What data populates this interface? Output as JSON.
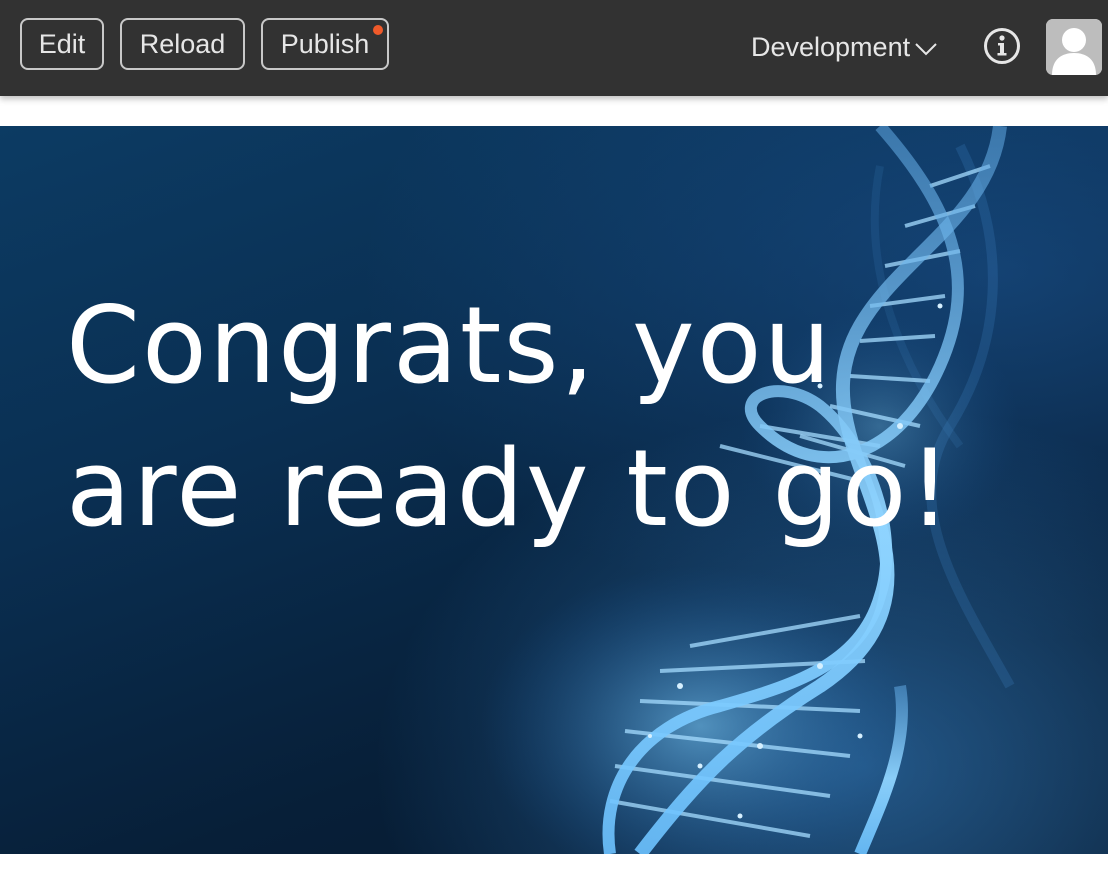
{
  "toolbar": {
    "edit_label": "Edit",
    "reload_label": "Reload",
    "publish_label": "Publish",
    "publish_notification": true,
    "environment": "Development",
    "info_icon": "info-icon",
    "avatar_icon": "user-avatar-icon"
  },
  "hero": {
    "headline": "Congrats, you\nare ready to go!",
    "image": "dna-helix"
  },
  "colors": {
    "toolbar_bg": "#323232",
    "notification_dot": "#f05a2a",
    "hero_bg": "#0a2f52",
    "hero_text": "#ffffff"
  }
}
